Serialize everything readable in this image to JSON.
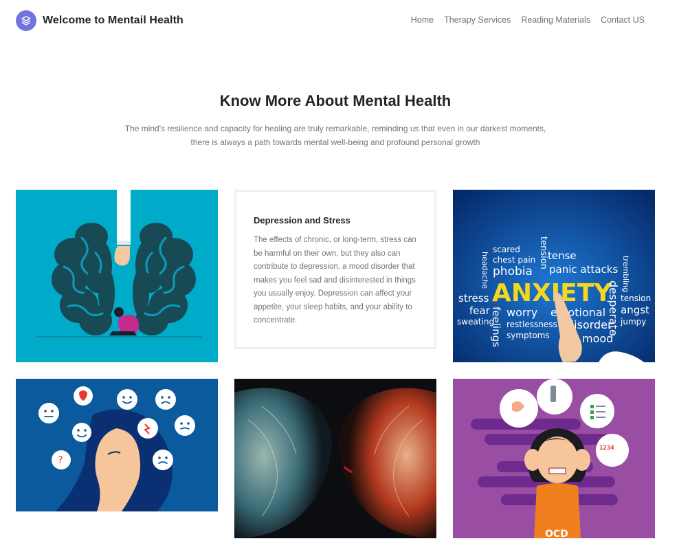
{
  "header": {
    "brand": "Welcome to Mentail Health",
    "logo_icon": "layers-icon",
    "nav": [
      "Home",
      "Therapy Services",
      "Reading Materials",
      "Contact US"
    ]
  },
  "hero": {
    "title": "Know More About Mental Health",
    "text": "The mind's resilience and capacity for healing are truly remarkable, reminding us that even in our darkest moments, there is always a path towards mental well-being and profound personal growth"
  },
  "card": {
    "title": "Depression and Stress",
    "text": "The effects of chronic, or long-term, stress can be harmful on their own, but they also can contribute to depression, a mood disorder that makes you feel sad and disinterested in things you usually enjoy. Depression can affect your appetite, your sleep habits, and your ability to concentrate."
  },
  "anxiety_image": {
    "words": [
      "scared",
      "chest pain",
      "tense",
      "phobia",
      "panic attacks",
      "headache",
      "tension",
      "trembling",
      "ANXIETY",
      "desperate",
      "tension",
      "stress",
      "fear",
      "feelings",
      "worry",
      "emotional",
      "angst",
      "sweating",
      "restlessness",
      "disorder",
      "jumpy",
      "symptoms",
      "mood"
    ]
  },
  "ocd_image": {
    "label": "OCD",
    "counter": "1234"
  },
  "colors": {
    "accent": "#6f74e0",
    "text_dark": "#212529",
    "text_muted": "#6c757d",
    "anxiety_yellow": "#f5d81c"
  }
}
